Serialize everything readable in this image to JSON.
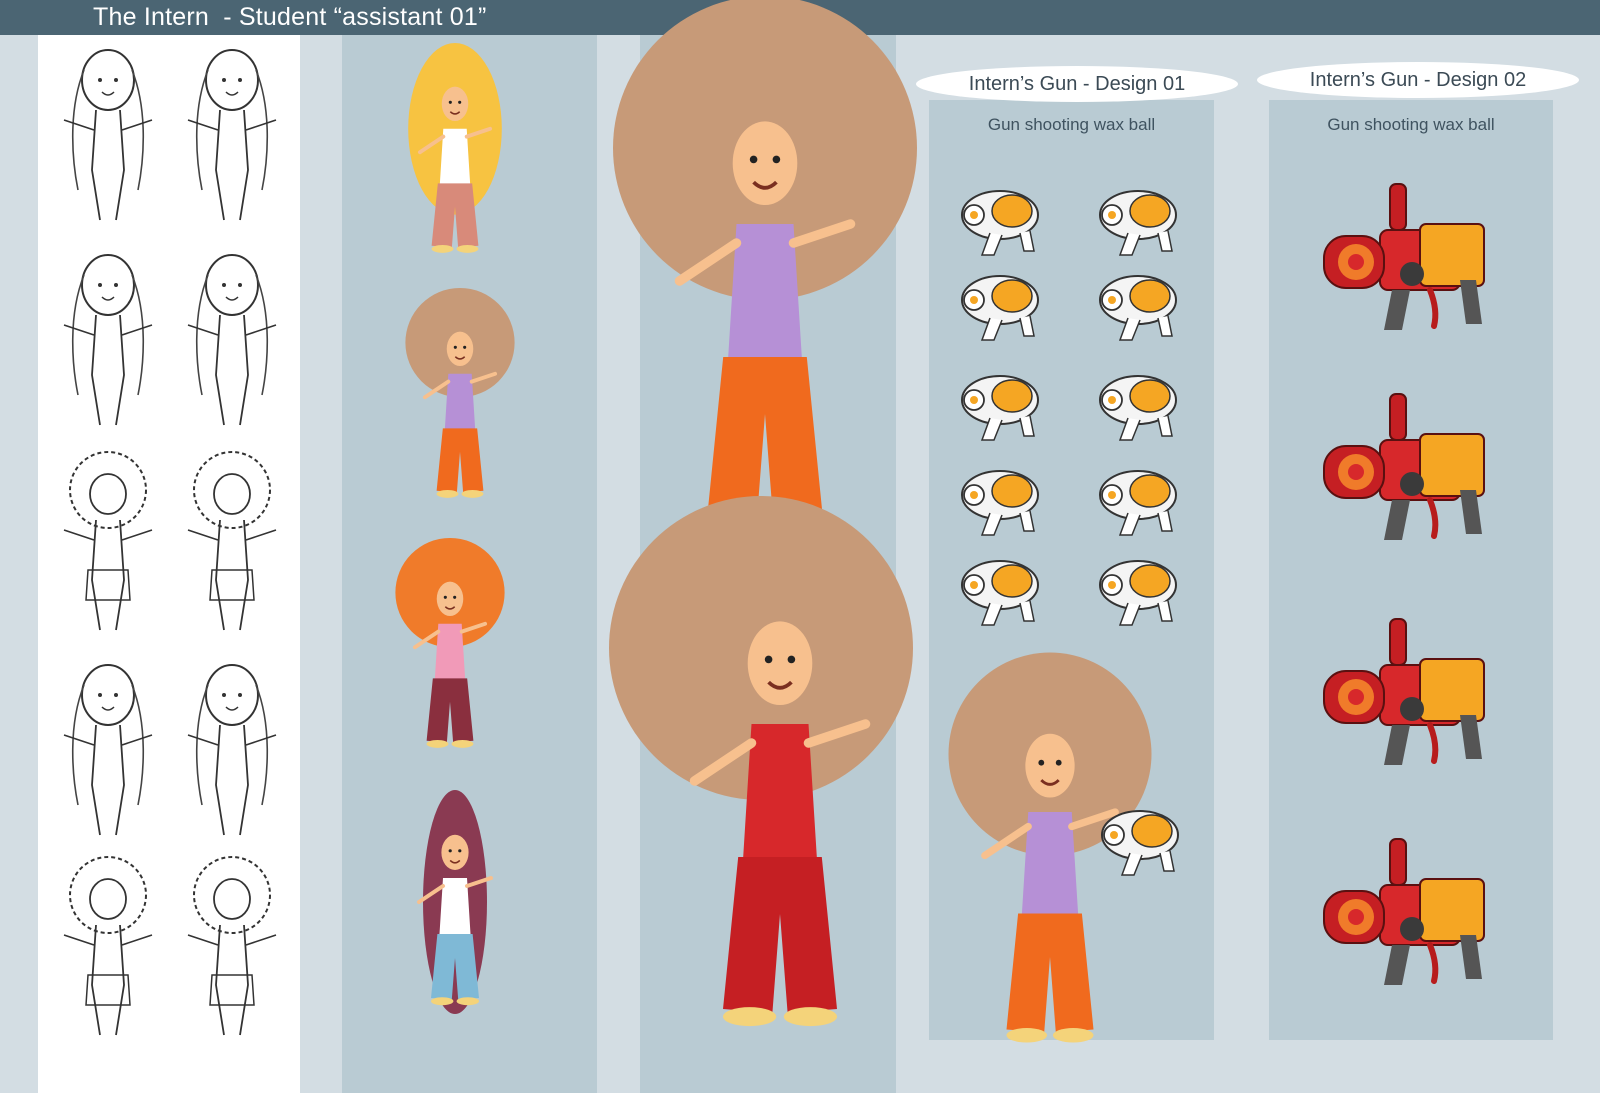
{
  "header": {
    "title": "The Intern  - Student “assistant 01”"
  },
  "gun_design_01": {
    "label": "Intern’s Gun - Design 01",
    "subtitle": "Gun shooting wax ball"
  },
  "gun_design_02": {
    "label": "Intern’s Gun - Design 02",
    "subtitle": "Gun shooting wax ball"
  },
  "colors": {
    "header_bg": "#4b6573",
    "panel_bg": "#b9cbd3",
    "page_bg": "#d3dde3",
    "hair_brown": "#c79a78",
    "pants_orange": "#f06a1e",
    "top_purple": "#b690d6",
    "gun_red": "#d7282b",
    "gun_yellow": "#f5a623"
  }
}
